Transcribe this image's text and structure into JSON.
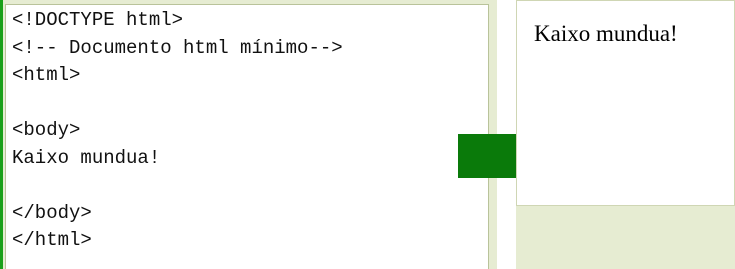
{
  "code_panel": {
    "lines": [
      "<!DOCTYPE html>",
      "<!-- Documento html mínimo-->",
      "<html>",
      "",
      "<body>",
      "Kaixo mundua!",
      "",
      "</body>",
      "</html>"
    ]
  },
  "arrow": {
    "icon": "right-arrow-icon",
    "color": "#0a7a0a"
  },
  "render_panel": {
    "text": "Kaixo mundua!"
  }
}
